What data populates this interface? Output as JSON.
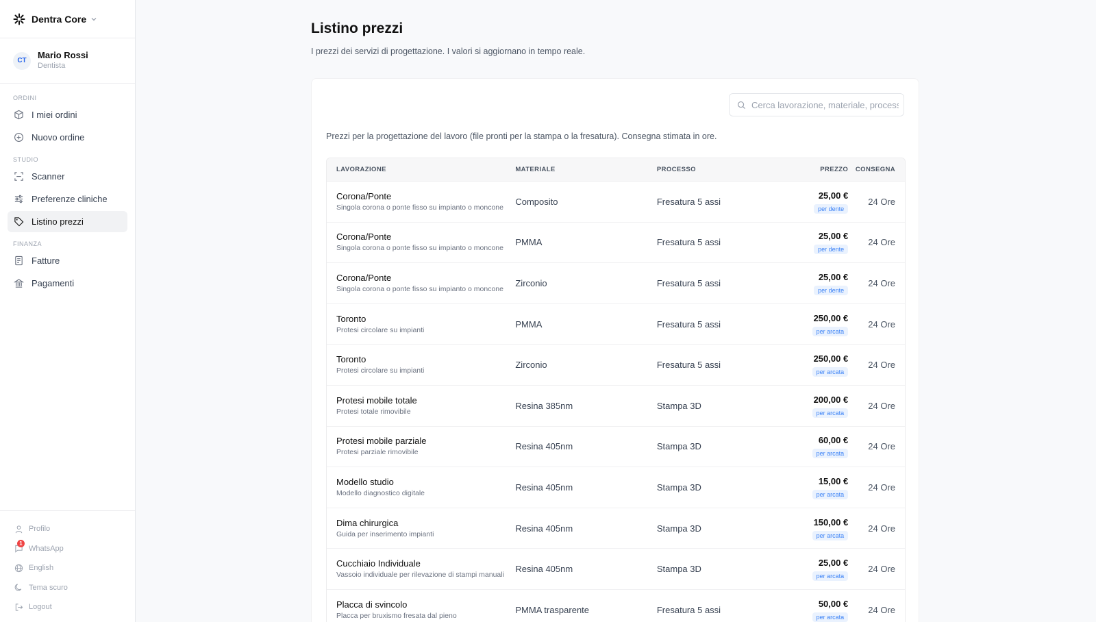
{
  "brand": {
    "name": "Dentra Core"
  },
  "user": {
    "initials": "CT",
    "name": "Mario Rossi",
    "role": "Dentista"
  },
  "nav": {
    "sections": [
      {
        "label": "ORDINI",
        "items": [
          {
            "label": "I miei ordini",
            "icon": "box-icon"
          },
          {
            "label": "Nuovo ordine",
            "icon": "plus-circle-icon"
          }
        ]
      },
      {
        "label": "STUDIO",
        "items": [
          {
            "label": "Scanner",
            "icon": "scan-icon"
          },
          {
            "label": "Preferenze cliniche",
            "icon": "sliders-icon"
          },
          {
            "label": "Listino prezzi",
            "icon": "tag-icon",
            "active": true
          }
        ]
      },
      {
        "label": "FINANZA",
        "items": [
          {
            "label": "Fatture",
            "icon": "invoice-icon"
          },
          {
            "label": "Pagamenti",
            "icon": "bank-icon"
          }
        ]
      }
    ]
  },
  "footer": {
    "items": [
      {
        "label": "Profilo",
        "icon": "user-icon"
      },
      {
        "label": "WhatsApp",
        "icon": "chat-icon",
        "badge": "1"
      },
      {
        "label": "English",
        "icon": "globe-icon"
      },
      {
        "label": "Tema scuro",
        "icon": "moon-icon"
      },
      {
        "label": "Logout",
        "icon": "logout-icon"
      }
    ]
  },
  "page": {
    "title": "Listino prezzi",
    "subtitle": "I prezzi dei servizi di progettazione. I valori si aggiornano in tempo reale."
  },
  "search": {
    "placeholder": "Cerca lavorazione, materiale, processo"
  },
  "card": {
    "description": "Prezzi per la progettazione del lavoro (file pronti per la stampa o la fresatura). Consegna stimata in ore."
  },
  "table": {
    "headers": {
      "lavorazione": "LAVORAZIONE",
      "materiale": "MATERIALE",
      "processo": "PROCESSO",
      "prezzo": "PREZZO",
      "consegna": "CONSEGNA"
    },
    "rows": [
      {
        "name": "Corona/Ponte",
        "desc": "Singola corona o ponte fisso su impianto o moncone",
        "material": "Composito",
        "process": "Fresatura 5 assi",
        "price": "25,00 €",
        "unit": "per dente",
        "delivery": "24 Ore"
      },
      {
        "name": "Corona/Ponte",
        "desc": "Singola corona o ponte fisso su impianto o moncone",
        "material": "PMMA",
        "process": "Fresatura 5 assi",
        "price": "25,00 €",
        "unit": "per dente",
        "delivery": "24 Ore"
      },
      {
        "name": "Corona/Ponte",
        "desc": "Singola corona o ponte fisso su impianto o moncone",
        "material": "Zirconio",
        "process": "Fresatura 5 assi",
        "price": "25,00 €",
        "unit": "per dente",
        "delivery": "24 Ore"
      },
      {
        "name": "Toronto",
        "desc": "Protesi circolare su impianti",
        "material": "PMMA",
        "process": "Fresatura 5 assi",
        "price": "250,00 €",
        "unit": "per arcata",
        "delivery": "24 Ore"
      },
      {
        "name": "Toronto",
        "desc": "Protesi circolare su impianti",
        "material": "Zirconio",
        "process": "Fresatura 5 assi",
        "price": "250,00 €",
        "unit": "per arcata",
        "delivery": "24 Ore"
      },
      {
        "name": "Protesi mobile totale",
        "desc": "Protesi totale rimovibile",
        "material": "Resina 385nm",
        "process": "Stampa 3D",
        "price": "200,00 €",
        "unit": "per arcata",
        "delivery": "24 Ore"
      },
      {
        "name": "Protesi mobile parziale",
        "desc": "Protesi parziale rimovibile",
        "material": "Resina 405nm",
        "process": "Stampa 3D",
        "price": "60,00 €",
        "unit": "per arcata",
        "delivery": "24 Ore"
      },
      {
        "name": "Modello studio",
        "desc": "Modello diagnostico digitale",
        "material": "Resina 405nm",
        "process": "Stampa 3D",
        "price": "15,00 €",
        "unit": "per arcata",
        "delivery": "24 Ore"
      },
      {
        "name": "Dima chirurgica",
        "desc": "Guida per inserimento impianti",
        "material": "Resina 405nm",
        "process": "Stampa 3D",
        "price": "150,00 €",
        "unit": "per arcata",
        "delivery": "24 Ore"
      },
      {
        "name": "Cucchiaio Individuale",
        "desc": "Vassoio individuale per rilevazione di stampi manuali",
        "material": "Resina 405nm",
        "process": "Stampa 3D",
        "price": "25,00 €",
        "unit": "per arcata",
        "delivery": "24 Ore"
      },
      {
        "name": "Placca di svincolo",
        "desc": "Placca per bruxismo fresata dal pieno",
        "material": "PMMA trasparente",
        "process": "Fresatura 5 assi",
        "price": "50,00 €",
        "unit": "per arcata",
        "delivery": "24 Ore"
      }
    ]
  },
  "colors": {
    "accent": "#3b82f6",
    "badge": "#ef4444",
    "active_bg": "#f1f2f4"
  }
}
